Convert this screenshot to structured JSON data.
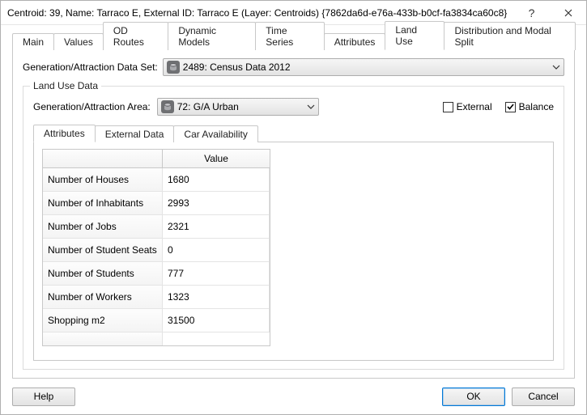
{
  "window": {
    "title": "Centroid: 39, Name: Tarraco E, External ID: Tarraco E (Layer: Centroids) {7862da6d-e76a-433b-b0cf-fa3834ca60c8}"
  },
  "tabs": [
    {
      "label": "Main"
    },
    {
      "label": "Values"
    },
    {
      "label": "OD Routes"
    },
    {
      "label": "Dynamic Models"
    },
    {
      "label": "Time Series"
    },
    {
      "label": "Attributes"
    },
    {
      "label": "Land Use"
    },
    {
      "label": "Distribution and Modal Split"
    }
  ],
  "dataset": {
    "label": "Generation/Attraction Data Set:",
    "value": "2489: Census Data 2012"
  },
  "group": {
    "title": "Land Use Data",
    "area_label": "Generation/Attraction Area:",
    "area_value": "72: G/A Urban",
    "external_label": "External",
    "external_checked": false,
    "balance_label": "Balance",
    "balance_checked": true
  },
  "inner_tabs": [
    {
      "label": "Attributes"
    },
    {
      "label": "External Data"
    },
    {
      "label": "Car Availability"
    }
  ],
  "table": {
    "value_header": "Value",
    "rows": [
      {
        "name": "Number of Houses",
        "value": "1680"
      },
      {
        "name": "Number of Inhabitants",
        "value": "2993"
      },
      {
        "name": "Number of Jobs",
        "value": "2321"
      },
      {
        "name": "Number of Student Seats",
        "value": "0"
      },
      {
        "name": "Number of Students",
        "value": "777"
      },
      {
        "name": "Number of Workers",
        "value": "1323"
      },
      {
        "name": "Shopping m2",
        "value": "31500"
      }
    ]
  },
  "buttons": {
    "help": "Help",
    "ok": "OK",
    "cancel": "Cancel"
  }
}
